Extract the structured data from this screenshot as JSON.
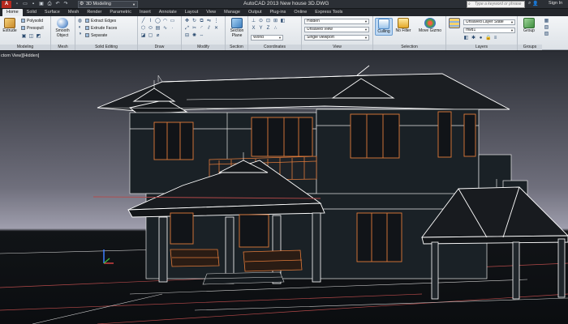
{
  "titlebar": {
    "logo": "A",
    "workspace": "3D Modeling",
    "title": "AutoCAD 2013    New house 3D.DWG",
    "search_placeholder": "Type a keyword or phrase",
    "signin": "Sign In"
  },
  "tabs": [
    "Home",
    "Solid",
    "Surface",
    "Mesh",
    "Render",
    "Parametric",
    "Insert",
    "Annotate",
    "Layout",
    "View",
    "Manage",
    "Output",
    "Plug-ins",
    "Online",
    "Express Tools"
  ],
  "ribbon": {
    "modeling": {
      "title": "Modeling",
      "extrude": "Extrude",
      "polysolid": "Polysolid",
      "presspull": "Presspull"
    },
    "mesh": {
      "title": "Mesh",
      "smooth": "Smooth Object"
    },
    "solid_editing": {
      "title": "Solid Editing",
      "extract_edges": "Extract Edges",
      "extrude_faces": "Extrude Faces",
      "separate": "Separate"
    },
    "draw": {
      "title": "Draw"
    },
    "modify": {
      "title": "Modify"
    },
    "section": {
      "title": "Section",
      "plane": "Section Plane"
    },
    "coordinates": {
      "title": "Coordinates",
      "world": "World"
    },
    "view": {
      "title": "View",
      "visual_style": "Hidden",
      "saved_view": "Unsaved View",
      "viewport": "Single viewport"
    },
    "selection": {
      "title": "Selection",
      "culling": "Culling",
      "no_filter": "No Filter",
      "move_gizmo": "Move Gizmo"
    },
    "layers": {
      "title": "Layers",
      "layer_state": "Unsaved Layer State",
      "layer_name": "rfwd1"
    },
    "groups": {
      "title": "Groups",
      "group": "Group"
    }
  },
  "viewport": {
    "label": "ctom View][Hidden]"
  },
  "colors": {
    "background": "#1e2024",
    "ribbon": "#e9ecef",
    "outline_white": "#ffffff",
    "outline_orange": "#e07a3a",
    "ground_line": "#b54a4a"
  }
}
